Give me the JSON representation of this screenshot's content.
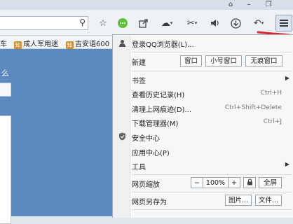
{
  "titlebar": {
    "buttons": [
      "pin-icon",
      "minimize-icon",
      "restore-icon"
    ]
  },
  "toolbar": {
    "address_value": "",
    "icons": [
      "search-icon",
      "star-icon",
      "chat-bubble-icon",
      "share-icon",
      "cloud-icon",
      "scissors-icon",
      "speaker-icon",
      "download-icon",
      "undo-icon",
      "menu-icon"
    ]
  },
  "bookmarks": [
    {
      "label": "车"
    },
    {
      "label": "成人军用迷",
      "icon": "知"
    },
    {
      "label": "吉安语600",
      "icon": "知"
    }
  ],
  "page": {
    "snippet": "么"
  },
  "menu": {
    "login": "登录QQ浏览器(L)...",
    "new_label": "新建",
    "new_buttons": [
      "窗口",
      "小号窗口",
      "无痕窗口"
    ],
    "bookmarks": "书签",
    "history": "查看历史记录(H)",
    "history_shortcut": "Ctrl+H",
    "clear": "清理上网痕迹(D)...",
    "clear_shortcut": "Ctrl+Shift+Delete",
    "downloads": "下载管理器(M)",
    "downloads_shortcut": "Ctrl+J",
    "security": "安全中心",
    "apps": "应用中心(P)",
    "tools": "工具",
    "zoom_label": "网页缩放",
    "zoom_minus": "−",
    "zoom_value": "100%",
    "zoom_plus": "+",
    "fullscreen": "全屏",
    "save_label": "网页另存为",
    "save_picture": "图片...",
    "save_file": "文件..."
  },
  "colors": {
    "accent": "#5b89c0",
    "annotation": "#d4282b"
  }
}
